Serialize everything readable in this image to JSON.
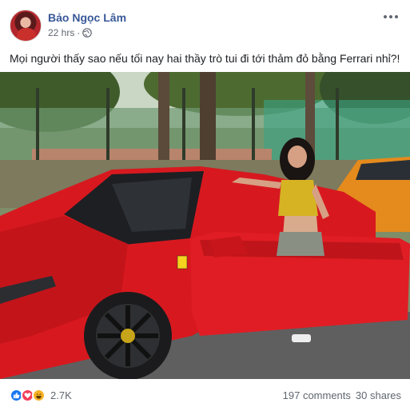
{
  "post": {
    "author": "Bảo Ngọc Lâm",
    "time": "22 hrs",
    "separator": "·",
    "caption": "Mọi người thấy sao nếu tối nay hai thầy trò tui đi tới thảm đỏ bằng Ferrari nhỉ?!",
    "reaction_count": "2.7K",
    "comments": "197 comments",
    "shares": "30 shares",
    "reaction_icons": [
      "like-icon",
      "love-icon",
      "haha-icon"
    ],
    "colors": {
      "author_link": "#385898",
      "like": "#1877f2",
      "love": "#f33e58",
      "haha": "#f7b125",
      "car_red": "#d7191f"
    }
  }
}
